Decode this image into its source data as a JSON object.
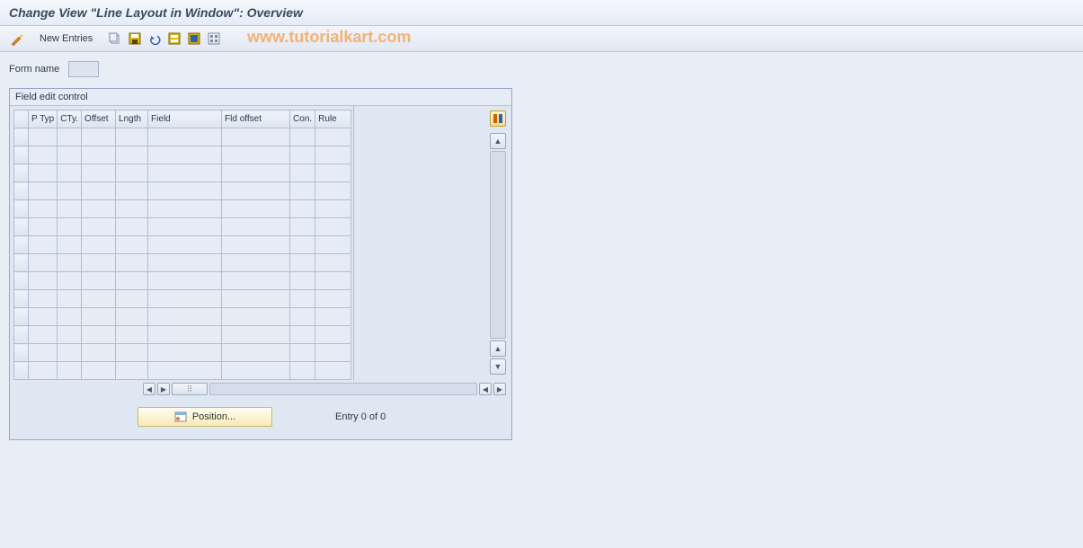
{
  "title": "Change View \"Line Layout in Window\": Overview",
  "toolbar": {
    "new_entries_label": "New Entries",
    "icons": [
      "pencil-wand-icon",
      "copy-icon",
      "save-icon",
      "undo-icon",
      "select-all-icon",
      "select-block-icon",
      "deselect-icon"
    ]
  },
  "watermark": "www.tutorialkart.com",
  "form": {
    "label": "Form name",
    "value": ""
  },
  "groupbox": {
    "title": "Field edit control",
    "columns": [
      "P Typ",
      "CTy.",
      "Offset",
      "Lngth",
      "Field",
      "Fld offset",
      "Con.",
      "Rule"
    ],
    "row_count": 14
  },
  "footer": {
    "position_label": "Position...",
    "entry_label": "Entry 0 of 0"
  }
}
